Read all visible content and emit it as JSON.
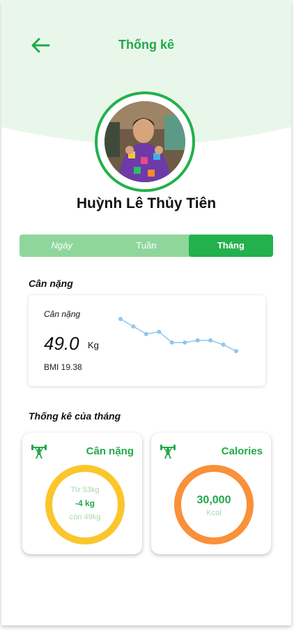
{
  "header": {
    "title": "Thống kê"
  },
  "profile": {
    "name": "Huỳnh Lê Thủy Tiên"
  },
  "tabs": [
    {
      "label": "Ngày",
      "active": false
    },
    {
      "label": "Tuần",
      "active": false
    },
    {
      "label": "Tháng",
      "active": true
    }
  ],
  "weight_section": {
    "title": "Cân nặng",
    "card_label": "Cân nặng",
    "value": "49.0",
    "unit": "Kg",
    "bmi": "BMI 19.38",
    "trend_points": [
      54.0,
      53.3,
      52.6,
      52.8,
      51.8,
      51.8,
      52.0,
      52.0,
      51.6,
      51.0
    ]
  },
  "month_section": {
    "title": "Thống kê của tháng",
    "weight_card": {
      "title": "Cân nặng",
      "from": "Từ 53kg",
      "change": "-4 kg",
      "remain": "còn 49kg",
      "ring_color": "#fbc62c"
    },
    "calories_card": {
      "title": "Calories",
      "value": "30,000",
      "unit": "Kcal",
      "ring_color": "#f9903a"
    }
  },
  "colors": {
    "accent": "#22b14c",
    "tab_bg": "#8fd69c",
    "header_bg": "#e9f7ea"
  }
}
